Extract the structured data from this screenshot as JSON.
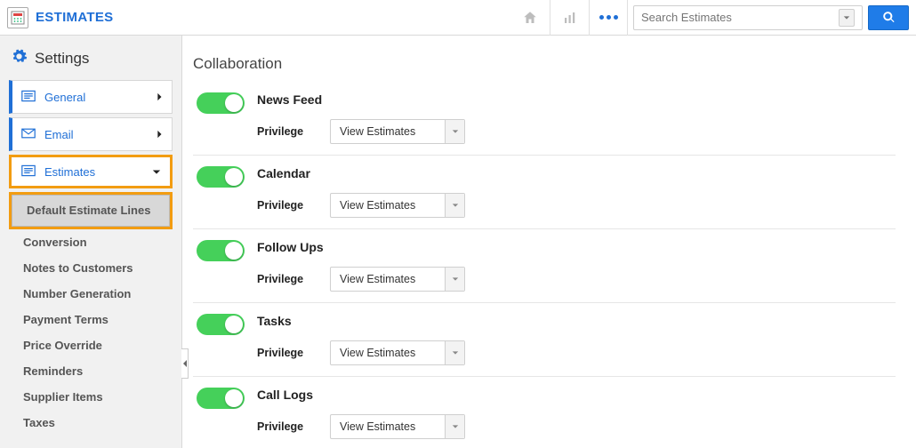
{
  "app": {
    "title": "ESTIMATES"
  },
  "search": {
    "placeholder": "Search Estimates"
  },
  "sidebar": {
    "title": "Settings",
    "items": [
      {
        "label": "General"
      },
      {
        "label": "Email"
      },
      {
        "label": "Estimates"
      }
    ],
    "subitems": [
      {
        "label": "Default Estimate Lines"
      },
      {
        "label": "Conversion"
      },
      {
        "label": "Notes to Customers"
      },
      {
        "label": "Number Generation"
      },
      {
        "label": "Payment Terms"
      },
      {
        "label": "Price Override"
      },
      {
        "label": "Reminders"
      },
      {
        "label": "Supplier Items"
      },
      {
        "label": "Taxes"
      }
    ]
  },
  "main": {
    "title": "Collaboration",
    "privilege_label": "Privilege",
    "sections": [
      {
        "title": "News Feed",
        "privilege": "View Estimates"
      },
      {
        "title": "Calendar",
        "privilege": "View Estimates"
      },
      {
        "title": "Follow Ups",
        "privilege": "View Estimates"
      },
      {
        "title": "Tasks",
        "privilege": "View Estimates"
      },
      {
        "title": "Call Logs",
        "privilege": "View Estimates"
      }
    ]
  }
}
